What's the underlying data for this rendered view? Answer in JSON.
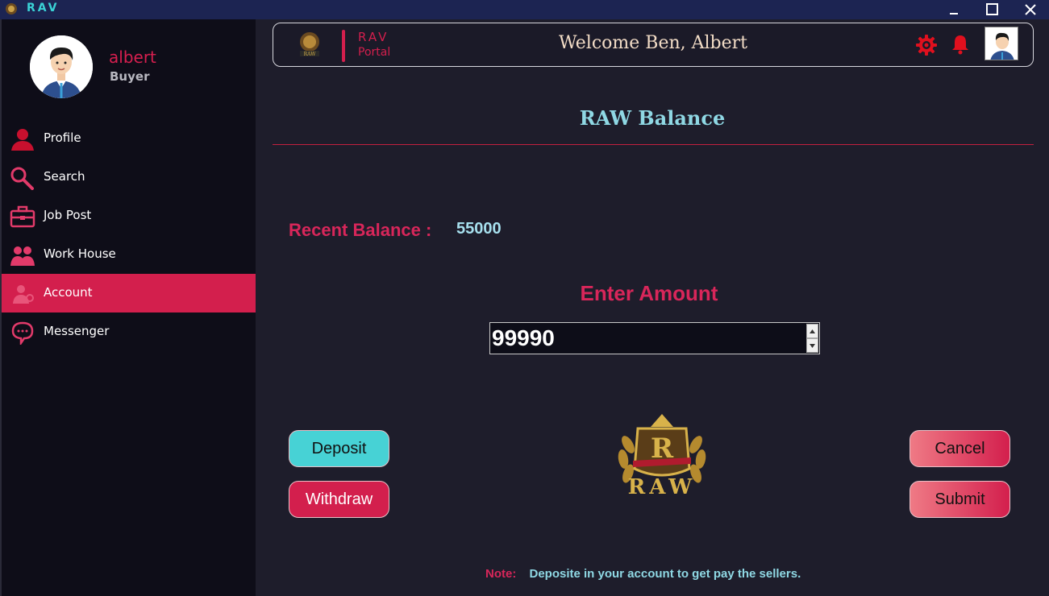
{
  "window": {
    "title": "RAV",
    "controls": [
      "minimize",
      "maximize",
      "close"
    ]
  },
  "sidebar": {
    "user": {
      "name": "albert",
      "role": "Buyer"
    },
    "items": [
      {
        "label": "Profile",
        "icon": "person-icon",
        "active": false
      },
      {
        "label": "Search",
        "icon": "search-icon",
        "active": false
      },
      {
        "label": "Job Post",
        "icon": "briefcase-icon",
        "active": false
      },
      {
        "label": "Work House",
        "icon": "group-icon",
        "active": false
      },
      {
        "label": "Account",
        "icon": "account-icon",
        "active": true
      },
      {
        "label": "Messenger",
        "icon": "chat-icon",
        "active": false
      }
    ]
  },
  "header": {
    "brand": "RAV",
    "subbrand": "Portal",
    "welcome": "Welcome Ben, Albert",
    "icons": [
      "gear-icon",
      "bell-icon",
      "avatar"
    ]
  },
  "page": {
    "title": "RAW Balance",
    "balance_label": "Recent Balance :",
    "balance_value": "55000",
    "amount_label": "Enter Amount",
    "amount_value": "99990",
    "buttons": {
      "deposit": "Deposit",
      "withdraw": "Withdraw",
      "cancel": "Cancel",
      "submit": "Submit"
    },
    "logo_text": "RAW",
    "note_key": "Note:",
    "note_text": "Deposite in your account to get pay the sellers."
  },
  "colors": {
    "accent": "#d31f4d",
    "teal": "#47d2d5",
    "title": "#8fd8e4",
    "sidebar_bg": "#0e0d18",
    "main_bg": "#1e1d2b"
  }
}
